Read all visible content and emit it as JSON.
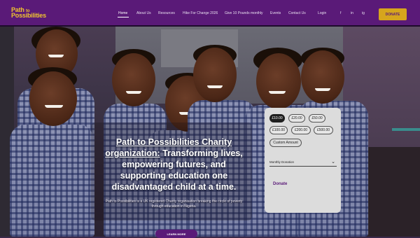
{
  "header": {
    "logo_line1": "Path",
    "logo_line1_small": "to",
    "logo_line2": "Possibilities",
    "nav": [
      {
        "label": "Home",
        "active": true
      },
      {
        "label": "About Us"
      },
      {
        "label": "Resources"
      },
      {
        "label": "Hike For Change 2026"
      },
      {
        "label": "Give 10 Pounds monthly"
      },
      {
        "label": "Events"
      },
      {
        "label": "Contact Us"
      }
    ],
    "login": "Login",
    "social": [
      "f",
      "in",
      "ig"
    ],
    "donate": "DONATE"
  },
  "hero": {
    "headline_part1": "Path to Possibilities Charity organization:",
    "headline_part2": " Transforming lives, empowering futures, and supporting education one disadvantaged child at a time.",
    "subtext": "Path to Possibilities is a UK registered Charity organisation breaking the circle of poverty through education in Nigeria.",
    "cta": "LEARN MORE"
  },
  "donation": {
    "amounts": [
      "£10.00",
      "£20.00",
      "£50.00",
      "£100.00",
      "£200.00",
      "£500.00"
    ],
    "selected_index": 0,
    "custom": "Custom Amount",
    "frequency": "Monthly Donation",
    "button": "Donate"
  },
  "colors": {
    "brand_purple": "#5a1a78",
    "brand_gold": "#d6a51d"
  }
}
